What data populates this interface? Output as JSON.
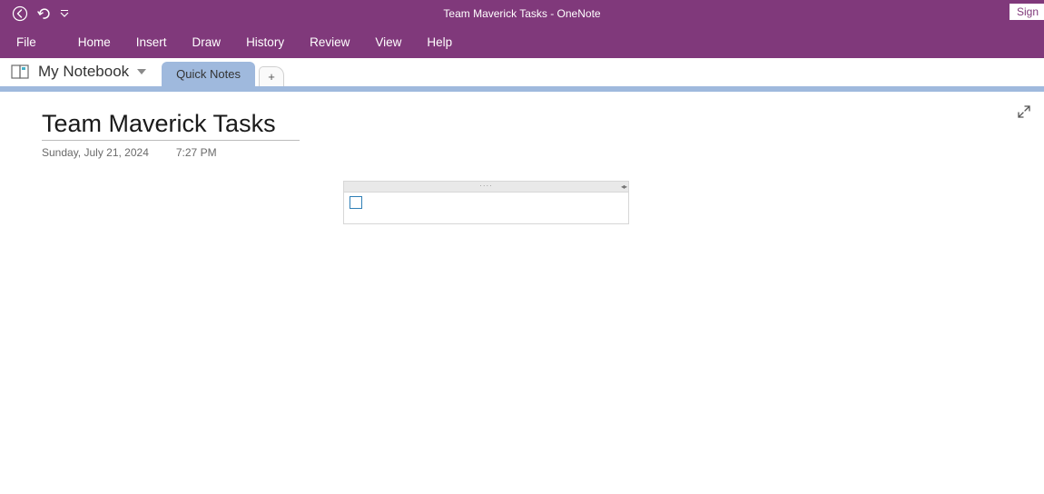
{
  "app": {
    "title": "Team Maverick Tasks  -  OneNote",
    "sign_in_label": "Sign"
  },
  "ribbon": {
    "tabs": [
      "File",
      "Home",
      "Insert",
      "Draw",
      "History",
      "Review",
      "View",
      "Help"
    ]
  },
  "notebook": {
    "name": "My Notebook"
  },
  "sections": {
    "active": "Quick Notes",
    "add_label": "+"
  },
  "page": {
    "title": "Team Maverick Tasks",
    "date": "Sunday, July 21, 2024",
    "time": "7:27 PM"
  }
}
